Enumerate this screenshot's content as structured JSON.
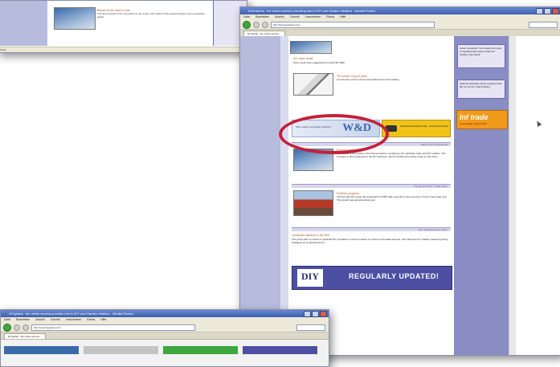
{
  "window_main": {
    "title": "DIYinternal - the online service providing info to DIY and Garden retailers - Mozilla Firefox",
    "menu": [
      "Datei",
      "Bearbeiten",
      "Ansicht",
      "Chronik",
      "Lesezeichen",
      "Extras",
      "Hilfe"
    ],
    "address": "http://www.diyglobal.com/",
    "tab": "DIYglobal - the online service...",
    "status": "Fertig"
  },
  "articles": [
    {
      "title": "DIY news detail",
      "text": "Some retail news suggested from April 6th 2009"
    },
    {
      "title": "The power of good paint",
      "text": "An overview of new colours and products from the industry"
    },
    {
      "title": "Emerging trends",
      "text": "The market is very active in the internet field for supplying to the hardware trade and DIY retailers. The company is also positioned in the DIY business, where it builds the product range for the future"
    },
    {
      "title": "Portfolio progress",
      "text": "The German DIY group has expanded its 2008 trade year with a new overview of how it has made new. The growth was generated last year"
    },
    {
      "title": "Landmark research in the field",
      "text": "The group start to present of potential DIY specialist or recent numbers on volume and retailer Europe, who have the DIY retailers research pricing strategies as competitiveness?"
    }
  ],
  "sections": [
    "News & DIY international",
    "The growth at DIY (retail) topics",
    "DIY retail (customer) topics"
  ],
  "banner": {
    "wd_logo": "W&D",
    "wd_text": "Web retailer and global collection",
    "yellow_text": "Wettbewerbsanalyse Bau- und Gartenmärkte"
  },
  "diy_banner": {
    "logo": "DIY",
    "text": "REGULARLY UPDATED!"
  },
  "right_col": {
    "newsletter": "Latest newsletter: Our weekly summary of significant European retail and industry information",
    "box2": "National Hardware Show Leading trade fair for the DIY retail industry",
    "infotrade_title": "Inf trade",
    "infotrade_sub": "the knowledge network for DIY"
  },
  "window_tl": {
    "article_title": "Brands at the point of sale",
    "article_text": "The best practice of the new player on the scene, with sales for the several brands in the competitive space",
    "status": "Fertig"
  },
  "window_bl": {
    "title": "DIYglobal - the online service provides info to DIY and Garden retailers - Mozilla Firefox",
    "address": "http://www.diyglobal.com/",
    "tab": "DIYglobal - the online service..."
  },
  "colors": {
    "highlight": "#c4203a",
    "rcol": "#8a8dc4",
    "infotrade": "#f29a1a",
    "diy": "#4c4fa2"
  }
}
